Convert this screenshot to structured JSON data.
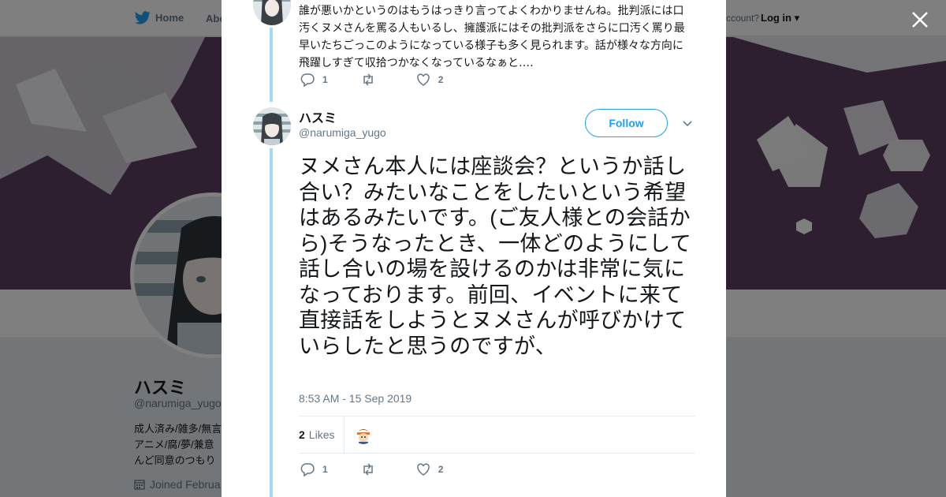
{
  "nav": {
    "home_label": "Home",
    "about_label": "Abo",
    "account_prompt": "ccount?",
    "login_label": "Log in"
  },
  "profile": {
    "name": "ハスミ",
    "handle": "@narumiga_yugo",
    "bio_lines": [
      "成人済み/雑多/無言",
      "アニメ/腐/夢/兼意",
      "んど同意のつもり"
    ],
    "joined": "Joined Februa"
  },
  "previous_tweet": {
    "text": "誰が悪いかというのはもうはっきり言ってよくわかりませんね。批判派には口汚くヌメさんを罵る人もいるし、擁護派にはその批判派をさらに口汚く罵り最早いたちごっこのようになっている様子も多く見られます。話が様々な方向に飛躍しすぎて収拾つかなくなっているなぁと‥‥",
    "replies": "1",
    "retweets": "",
    "likes": "2"
  },
  "tweet": {
    "author_name": "ハスミ",
    "author_handle": "@narumiga_yugo",
    "follow_label": "Follow",
    "text": "ヌメさん本人には座談会？というか話し合い？みたいなことをしたいという希望はあるみたいです。(ご友人様との会話から)そうなったとき、一体どのようにして話し合いの場を設けるのかは非常に気になっております。前回、イベントに来て直接話をしようとヌメさんが呼びかけていらしたと思うのですが、",
    "timestamp": "8:53 AM - 15 Sep 2019",
    "likes_count": "2",
    "likes_label": "Likes",
    "replies": "1",
    "retweets": "",
    "likes": "2"
  },
  "icons": {
    "logo": "bird-icon",
    "close": "close-icon",
    "reply": "reply-icon",
    "retweet": "retweet-icon",
    "like": "heart-icon",
    "caret": "chevron-down-icon",
    "calendar": "calendar-icon"
  },
  "colors": {
    "brand": "#1da1f2",
    "thread_line": "#a4d9f5",
    "text": "#14171a",
    "muted": "#657786",
    "banner": "#5b3f5e"
  }
}
